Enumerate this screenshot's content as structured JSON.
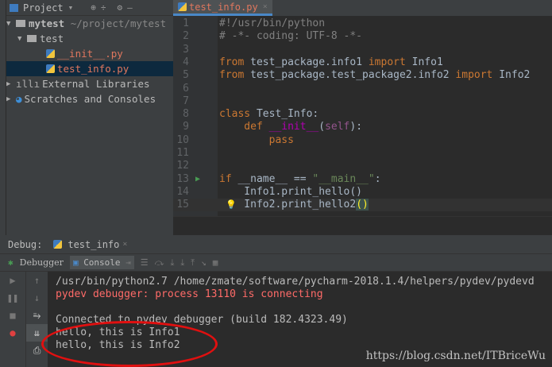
{
  "project": {
    "title": "Project",
    "root": "mytest",
    "root_path": "~/project/mytest",
    "folder": "test",
    "files": [
      "__init__.py",
      "test_info.py"
    ],
    "external": "External Libraries",
    "scratches": "Scratches and Consoles"
  },
  "editor": {
    "tab": "test_info.py",
    "lines": [
      [
        {
          "t": "#!/usr/bin/python",
          "c": "cm"
        }
      ],
      [
        {
          "t": "# -*- coding: UTF-8 -*-",
          "c": "cm"
        }
      ],
      [],
      [
        {
          "t": "from",
          "c": "kw"
        },
        {
          "t": " test_package.info1 "
        },
        {
          "t": "import",
          "c": "kw"
        },
        {
          "t": " Info1"
        }
      ],
      [
        {
          "t": "from",
          "c": "kw"
        },
        {
          "t": " test_package.test_package2.info2 "
        },
        {
          "t": "import",
          "c": "kw"
        },
        {
          "t": " Info2"
        }
      ],
      [],
      [],
      [
        {
          "t": "class",
          "c": "kw"
        },
        {
          "t": " Test_Info:"
        }
      ],
      [
        {
          "t": "    def",
          "c": "kw"
        },
        {
          "t": " "
        },
        {
          "t": "__init__",
          "c": "mg"
        },
        {
          "t": "("
        },
        {
          "t": "self",
          "c": "sf"
        },
        {
          "t": "):"
        }
      ],
      [
        {
          "t": "        pass",
          "c": "kw"
        }
      ],
      [],
      [],
      [
        {
          "t": "if",
          "c": "kw"
        },
        {
          "t": " __name__ == "
        },
        {
          "t": "\"__main__\"",
          "c": "st"
        },
        {
          "t": ":"
        }
      ],
      [
        {
          "t": "    Info1.print_hello()"
        }
      ],
      [
        {
          "t": "    Info2.print_hello2"
        },
        {
          "t": "()",
          "c": "br"
        }
      ]
    ]
  },
  "debug": {
    "label": "Debug:",
    "session": "test_info",
    "debugger_tab": "Debugger",
    "console_tab": "Console",
    "console": [
      "/usr/bin/python2.7 /home/zmate/software/pycharm-2018.1.4/helpers/pydev/pydevd",
      "pydev debugger: process 13110 is connecting",
      "",
      "Connected to pydev debugger (build 182.4323.49)",
      "hello, this is Info1",
      "hello, this is Info2"
    ]
  },
  "watermark": "https://blog.csdn.net/ITBriceWu"
}
